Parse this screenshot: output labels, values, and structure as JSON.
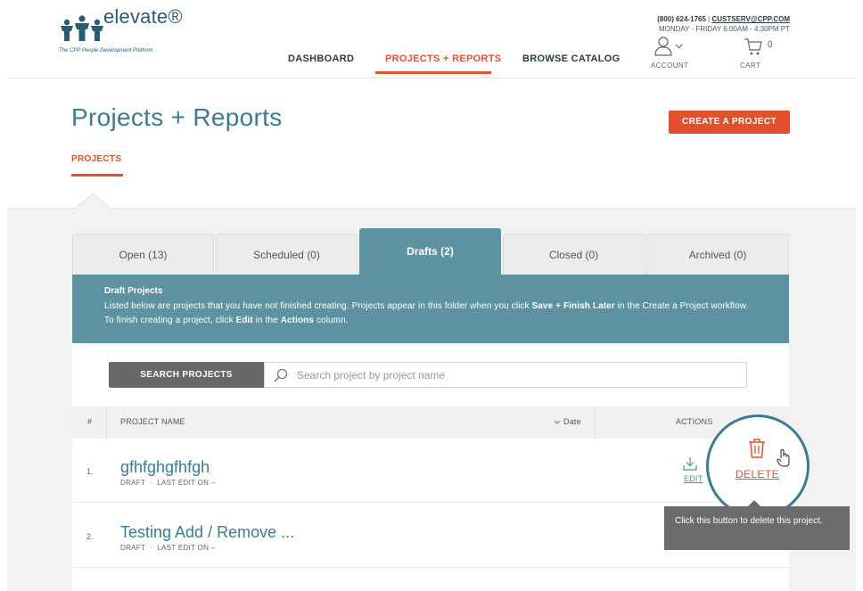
{
  "header": {
    "logo": {
      "wordmark": "elevate®",
      "tagline": "The CPP People Development Platform"
    },
    "nav": [
      {
        "label": "DASHBOARD"
      },
      {
        "label": "PROJECTS + REPORTS",
        "active": true
      },
      {
        "label": "BROWSE CATALOG"
      }
    ],
    "contact": {
      "phone": "(800) 624-1765",
      "separator": "|",
      "email": "CUSTSERV@CPP.COM",
      "hours": "MONDAY - FRIDAY 6:00AM - 4:30PM PT"
    },
    "account_label": "ACCOUNT",
    "cart_label": "CART",
    "cart_count": "0"
  },
  "page": {
    "title": "Projects + Reports",
    "create_button": "CREATE A PROJECT",
    "sub_tab": "PROJECTS"
  },
  "tabs": [
    {
      "label": "Open (13)"
    },
    {
      "label": "Scheduled (0)"
    },
    {
      "label": "Drafts (2)",
      "active": true
    },
    {
      "label": "Closed (0)"
    },
    {
      "label": "Archived (0)"
    }
  ],
  "info": {
    "title": "Draft Projects",
    "text_1": "Listed below are projects that you have not finished creating. Projects appear in this folder when you click ",
    "bold_1": "Save + Finish Later",
    "text_2": " in the Create a Project workflow. To finish creating a project, click ",
    "bold_2": "Edit",
    "text_3": " in the ",
    "bold_3": "Actions",
    "text_4": " column."
  },
  "search": {
    "button_label": "SEARCH PROJECTS",
    "placeholder": "Search project by project name"
  },
  "table": {
    "headers": {
      "num": "#",
      "name": "PROJECT NAME",
      "date": "Date",
      "actions": "ACTIONS"
    },
    "rows": [
      {
        "num": "1.",
        "name": "gfhfghgfhfgh",
        "status": "DRAFT",
        "sep": "·",
        "last_edit": "LAST EDIT ON –"
      },
      {
        "num": "2.",
        "name": "Testing Add / Remove ...",
        "status": "DRAFT",
        "sep": "·",
        "last_edit": "LAST EDIT ON –"
      }
    ],
    "edit_label": "EDIT",
    "delete_label": "DELETE"
  },
  "tooltip": {
    "text": "Click this button to delete this project."
  },
  "colors": {
    "accent": "#e4502e",
    "teal": "#5d93a0",
    "title_blue": "#3a7c91"
  }
}
